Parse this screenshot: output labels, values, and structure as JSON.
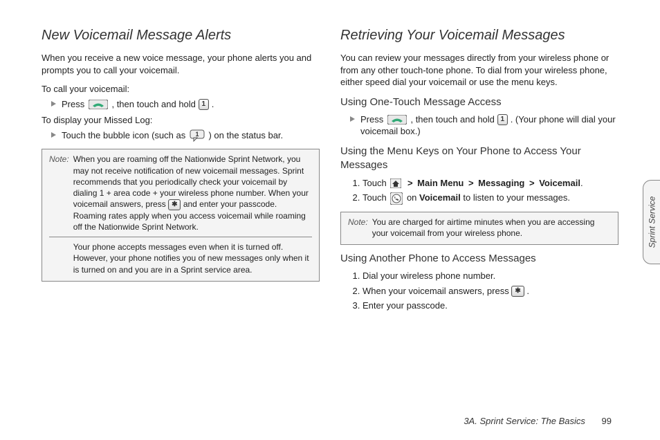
{
  "left": {
    "heading": "New Voicemail Message Alerts",
    "lead": "When you receive a new voice message, your phone alerts you and prompts you to call your voicemail.",
    "sub1": "To call your voicemail:",
    "bullet1a": "Press ",
    "bullet1b": ", then touch and hold ",
    "bullet1c": ".",
    "sub2": "To display your Missed Log:",
    "bullet2a": "Touch the bubble icon (such as ",
    "bullet2b": ") on the status bar.",
    "note_label": "Note:",
    "note_p1": "When you are roaming off the Nationwide Sprint Network, you may not receive notification of new voicemail messages. Sprint recommends that you periodically check your voicemail by dialing 1 + area code + your wireless phone number. When your voicemail answers, press ",
    "note_p1b": " and enter your passcode. Roaming rates apply when you access voicemail while roaming off the Nationwide Sprint Network.",
    "note_p2": "Your phone accepts messages even when it is turned off. However, your phone notifies you of new messages only when it is turned on and you are in a Sprint service area."
  },
  "right": {
    "heading": "Retrieving Your Voicemail Messages",
    "lead": "You can review your messages directly from your wireless phone or from any other touch-tone phone. To dial from your wireless phone, either speed dial your voicemail or use the menu keys.",
    "h3a": "Using One-Touch Message Access",
    "bulletAa": "Press ",
    "bulletAb": ", then touch and hold ",
    "bulletAc": ". (Your phone will dial your voicemail box.)",
    "h3b": "Using the Menu Keys on Your Phone to Access Your Messages",
    "li1a": "Touch ",
    "menu1": "Main Menu",
    "menu2": "Messaging",
    "menu3": "Voicemail",
    "li2a": "Touch ",
    "li2b": " on ",
    "li2b_bold": "Voicemail",
    "li2c": " to listen to your messages.",
    "note_label": "Note:",
    "note_body": "You are charged for airtime minutes when you are accessing your voicemail from your wireless phone.",
    "h3c": "Using Another Phone to Access Messages",
    "ol2_1": "Dial your wireless phone number.",
    "ol2_2a": "When your voicemail answers, press ",
    "ol2_2b": ".",
    "ol2_3": "Enter your passcode."
  },
  "keys": {
    "one": "1",
    "star": "✱",
    "gt": ">"
  },
  "tab": "Sprint Service",
  "footer_title": "3A. Sprint Service: The Basics",
  "footer_page": "99"
}
